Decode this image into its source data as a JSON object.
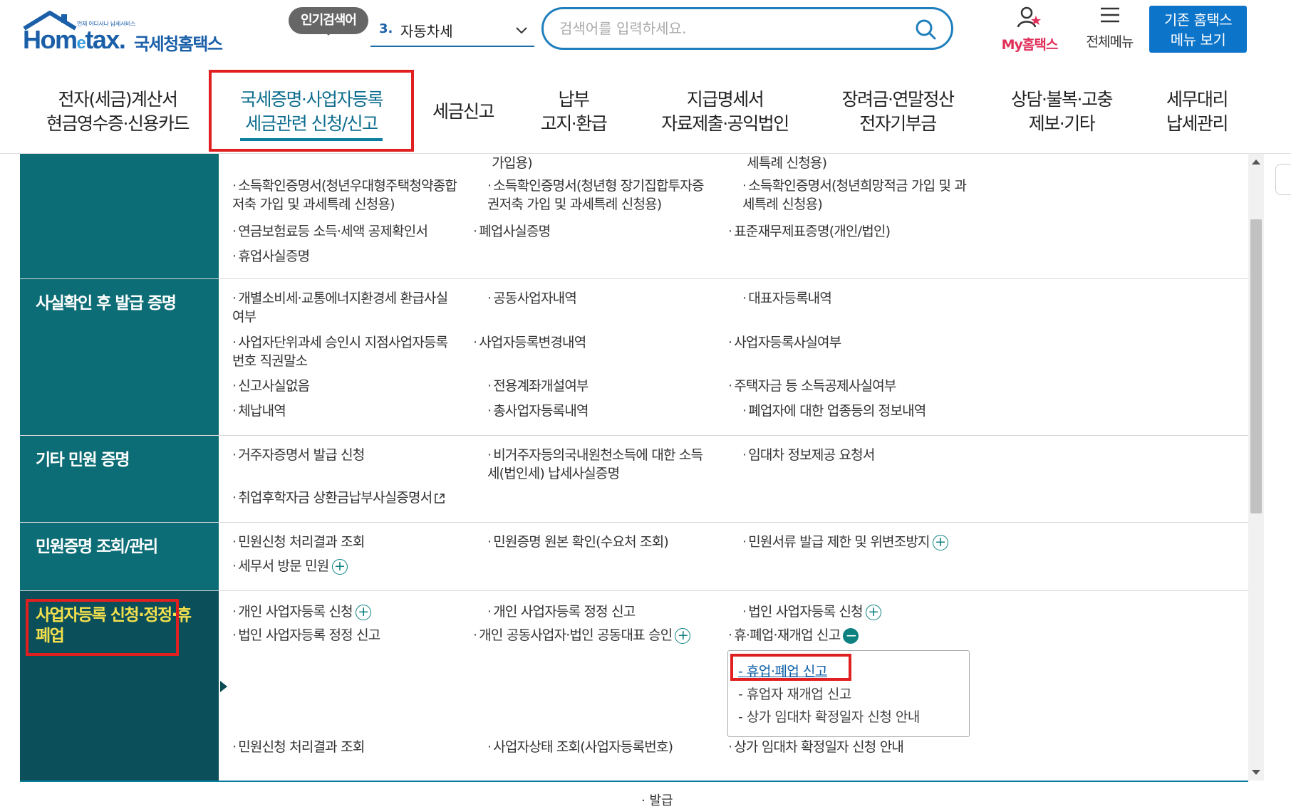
{
  "header": {
    "logo_slogan": "언제 어디서나 납세서비스",
    "logo_brand_a": "Hom",
    "logo_brand_e": "e",
    "logo_brand_b": "tax.",
    "logo_sub": "국세청홈택스",
    "popular_badge": "인기검색어",
    "popular_rank": "3.",
    "popular_term": "자동차세",
    "search_placeholder": "검색어를 입력하세요.",
    "my_label": "My홈택스",
    "allmenu_label": "전체메뉴",
    "old_menu_line1": "기존 홈택스",
    "old_menu_line2": "메뉴 보기"
  },
  "nav": [
    {
      "label": "전자(세금)계산서\n현금영수증·신용카드"
    },
    {
      "label": "국세증명·사업자등록\n세금관련 신청/신고"
    },
    {
      "label": "세금신고"
    },
    {
      "label": "납부\n고지·환급"
    },
    {
      "label": "지급명세서\n자료제출·공익법인"
    },
    {
      "label": "장려금·연말정산\n전자기부금"
    },
    {
      "label": "상담·불복·고충\n제보·기타"
    },
    {
      "label": "세무대리\n납세관리"
    }
  ],
  "sections": {
    "top": {
      "frag1": "가입용)",
      "frag2": "세특례 신청용)",
      "l1": "소득확인증명서(청년우대형주택청약종합\n저축 가입 및 과세특례 신청용)",
      "l2": "소득확인증명서(청년형 장기집합투자증\n권저축 가입 및 과세특례 신청용)",
      "l3": "소득확인증명서(청년희망적금 가입 및 과\n세특례 신청용)",
      "l4": "연금보험료등 소득·세액 공제확인서",
      "l5": "폐업사실증명",
      "l6": "표준재무제표증명(개인/법인)",
      "l7": "휴업사실증명"
    },
    "fact": {
      "title": "사실확인 후 발급 증명",
      "l1": "개별소비세·교통에너지환경세 환급사실\n여부",
      "l2": "공동사업자내역",
      "l3": "대표자등록내역",
      "l4": "사업자단위과세 승인시 지점사업자등록\n번호 직권말소",
      "l5": "사업자등록변경내역",
      "l6": "사업자등록사실여부",
      "l7": "신고사실없음",
      "l8": "전용계좌개설여부",
      "l9": "주택자금 등 소득공제사실여부",
      "l10": "체납내역",
      "l11": "총사업자등록내역",
      "l12": "폐업자에 대한 업종등의 정보내역"
    },
    "etc": {
      "title": "기타 민원 증명",
      "l1": "거주자증명서 발급 신청",
      "l2": "비거주자등의국내원천소득에 대한 소득\n세(법인세) 납세사실증명",
      "l3": "임대차 정보제공 요청서",
      "l4": "취업후학자금 상환금납부사실증명서"
    },
    "inquiry": {
      "title": "민원증명 조회/관리",
      "l1": "민원신청 처리결과 조회",
      "l2": "민원증명 원본 확인(수요처 조회)",
      "l3": "민원서류 발급 제한 및 위변조방지",
      "l4": "세무서 방문 민원"
    },
    "bizreg": {
      "title": "사업자등록 신청·정정·휴폐업",
      "l1": "개인 사업자등록 신청",
      "l2": "개인 사업자등록 정정 신고",
      "l3": "법인 사업자등록 신청",
      "l4": "법인 사업자등록 정정 신고",
      "l5": "개인 공동사업자·법인 공동대표 승인",
      "l6": "휴·폐업·재개업 신고",
      "sub1": "휴업·폐업 신고",
      "sub2": "휴업자 재개업 신고",
      "sub3": "상가 임대차 확정일자 신청 안내",
      "l7": "민원신청 처리결과 조회",
      "l8": "사업자상태 조회(사업자등록번호)",
      "l9": "상가 임대차 확정일자 신청 안내"
    }
  },
  "bottom_peek": "발급",
  "colors": {
    "brand_blue": "#1a5fa8",
    "section_teal": "#0d6d76",
    "section_dark": "#0b4f5a",
    "highlight_red": "#e02020",
    "active_nav": "#0d6d8e"
  }
}
